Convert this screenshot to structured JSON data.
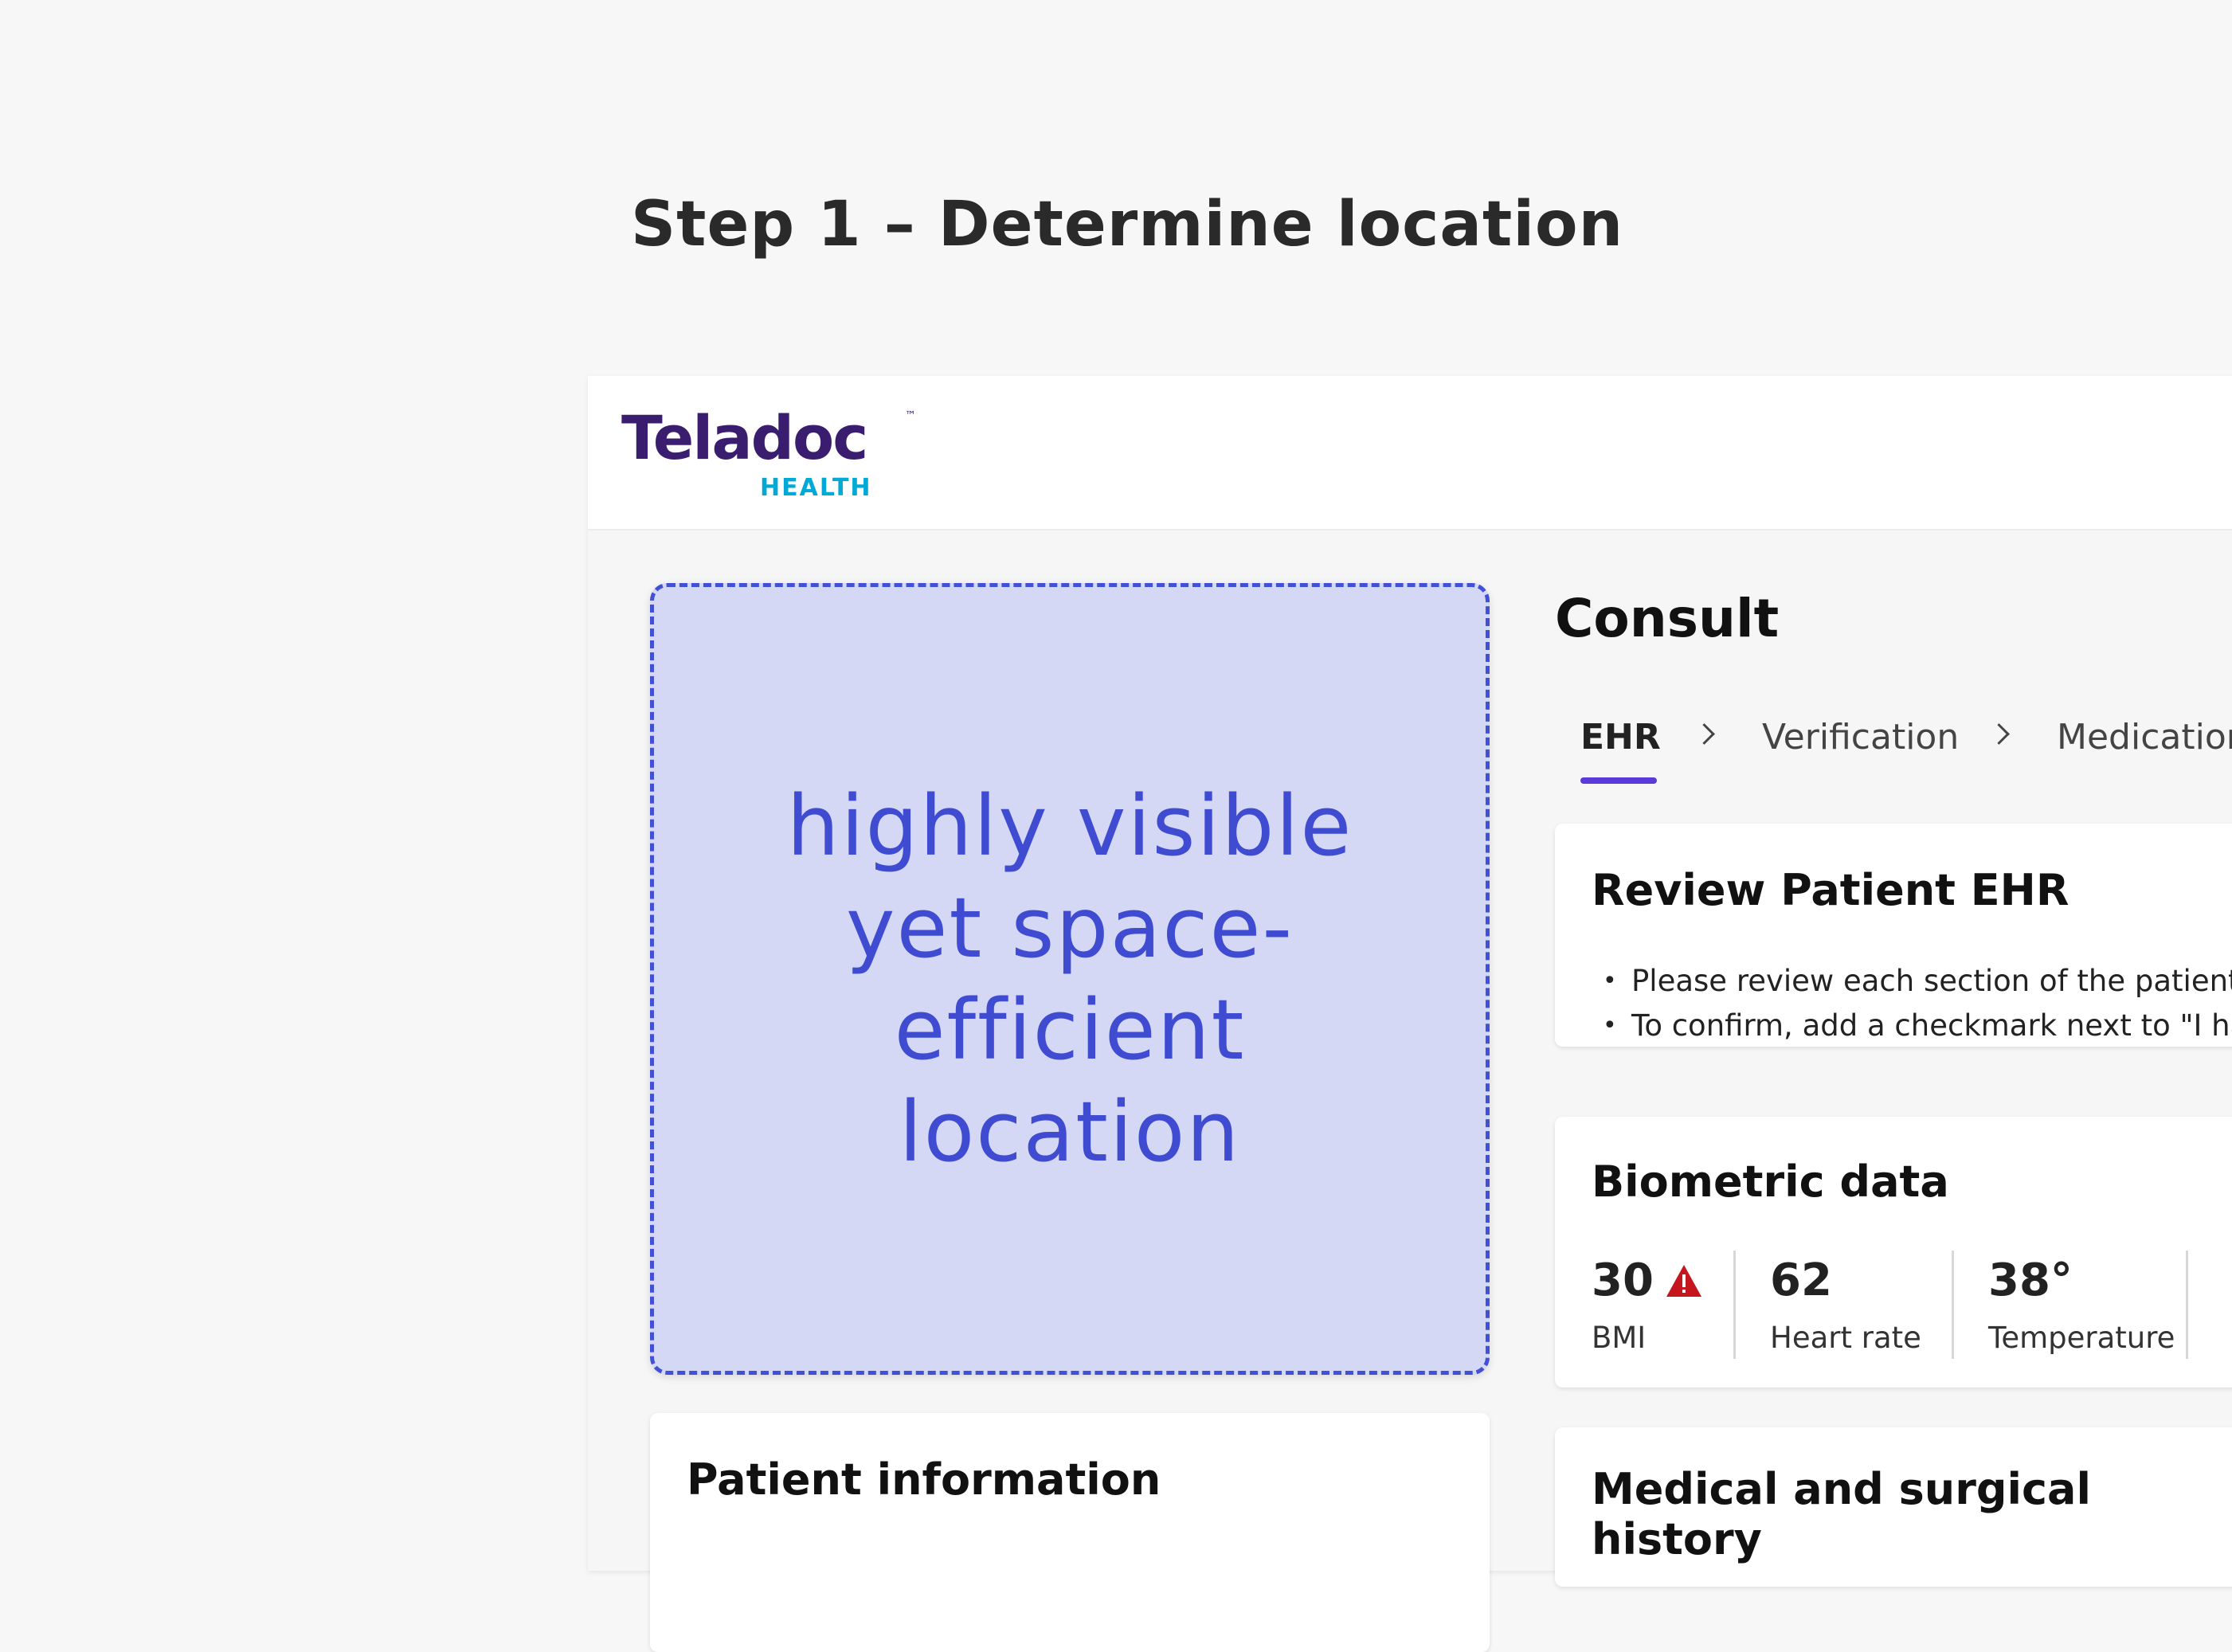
{
  "page": {
    "title": "Step 1 – Determine location"
  },
  "app": {
    "logo": {
      "name": "Teladoc",
      "sub": "HEALTH",
      "tm": "™"
    },
    "colors": {
      "brand_purple": "#3a1d6e",
      "brand_cyan": "#00a9d6",
      "accent": "#5a3bd9",
      "warning": "#c4161c"
    }
  },
  "placeholder": {
    "text": "highly visible yet space-efficient location"
  },
  "patient_card": {
    "title": "Patient information"
  },
  "consult": {
    "title": "Consult",
    "tabs": [
      {
        "label": "EHR",
        "active": true
      },
      {
        "label": "Verification",
        "active": false
      },
      {
        "label": "Medicatior",
        "active": false
      }
    ]
  },
  "review": {
    "title": "Review Patient EHR",
    "bullets": [
      "Please review each section of the patient",
      "To confirm, add a checkmark next to \"I ha"
    ]
  },
  "biometric": {
    "title": "Biometric data",
    "stats": [
      {
        "value": "30",
        "label": "BMI",
        "warning": true
      },
      {
        "value": "62",
        "label": "Heart rate",
        "warning": false
      },
      {
        "value": "38°",
        "label": "Temperature",
        "warning": false
      }
    ]
  },
  "history": {
    "title": "Medical and surgical history"
  }
}
